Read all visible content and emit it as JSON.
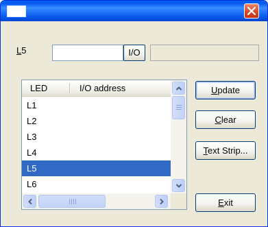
{
  "window": {
    "title": "",
    "close_glyph": "×"
  },
  "address_row": {
    "label": "L5",
    "label_mnemonic": "L",
    "label_rest": "5",
    "input_value": "",
    "io_button_label": "I/O",
    "readout_value": ""
  },
  "listview": {
    "columns": [
      "LED",
      "I/O address"
    ],
    "rows": [
      {
        "led": "L1",
        "address": ""
      },
      {
        "led": "L2",
        "address": ""
      },
      {
        "led": "L3",
        "address": ""
      },
      {
        "led": "L4",
        "address": ""
      },
      {
        "led": "L5",
        "address": ""
      },
      {
        "led": "L6",
        "address": ""
      }
    ],
    "selected_index": 4
  },
  "buttons": {
    "update": {
      "mnemonic": "U",
      "rest": "pdate"
    },
    "clear": {
      "mnemonic": "C",
      "rest": "lear"
    },
    "text_strip": {
      "mnemonic": "T",
      "rest": "ext Strip..."
    },
    "exit": {
      "mnemonic": "E",
      "rest": "xit"
    }
  },
  "icons": {
    "close": "close-icon",
    "scroll_up": "arrow-up-icon",
    "scroll_down": "arrow-down-icon",
    "scroll_left": "arrow-left-icon",
    "scroll_right": "arrow-right-icon"
  },
  "colors": {
    "titlebar": "#0a5fe8",
    "close_button": "#d9492a",
    "selection": "#316ac5",
    "dialog_face": "#ece9d8",
    "scroll_accent": "#4d6185"
  }
}
